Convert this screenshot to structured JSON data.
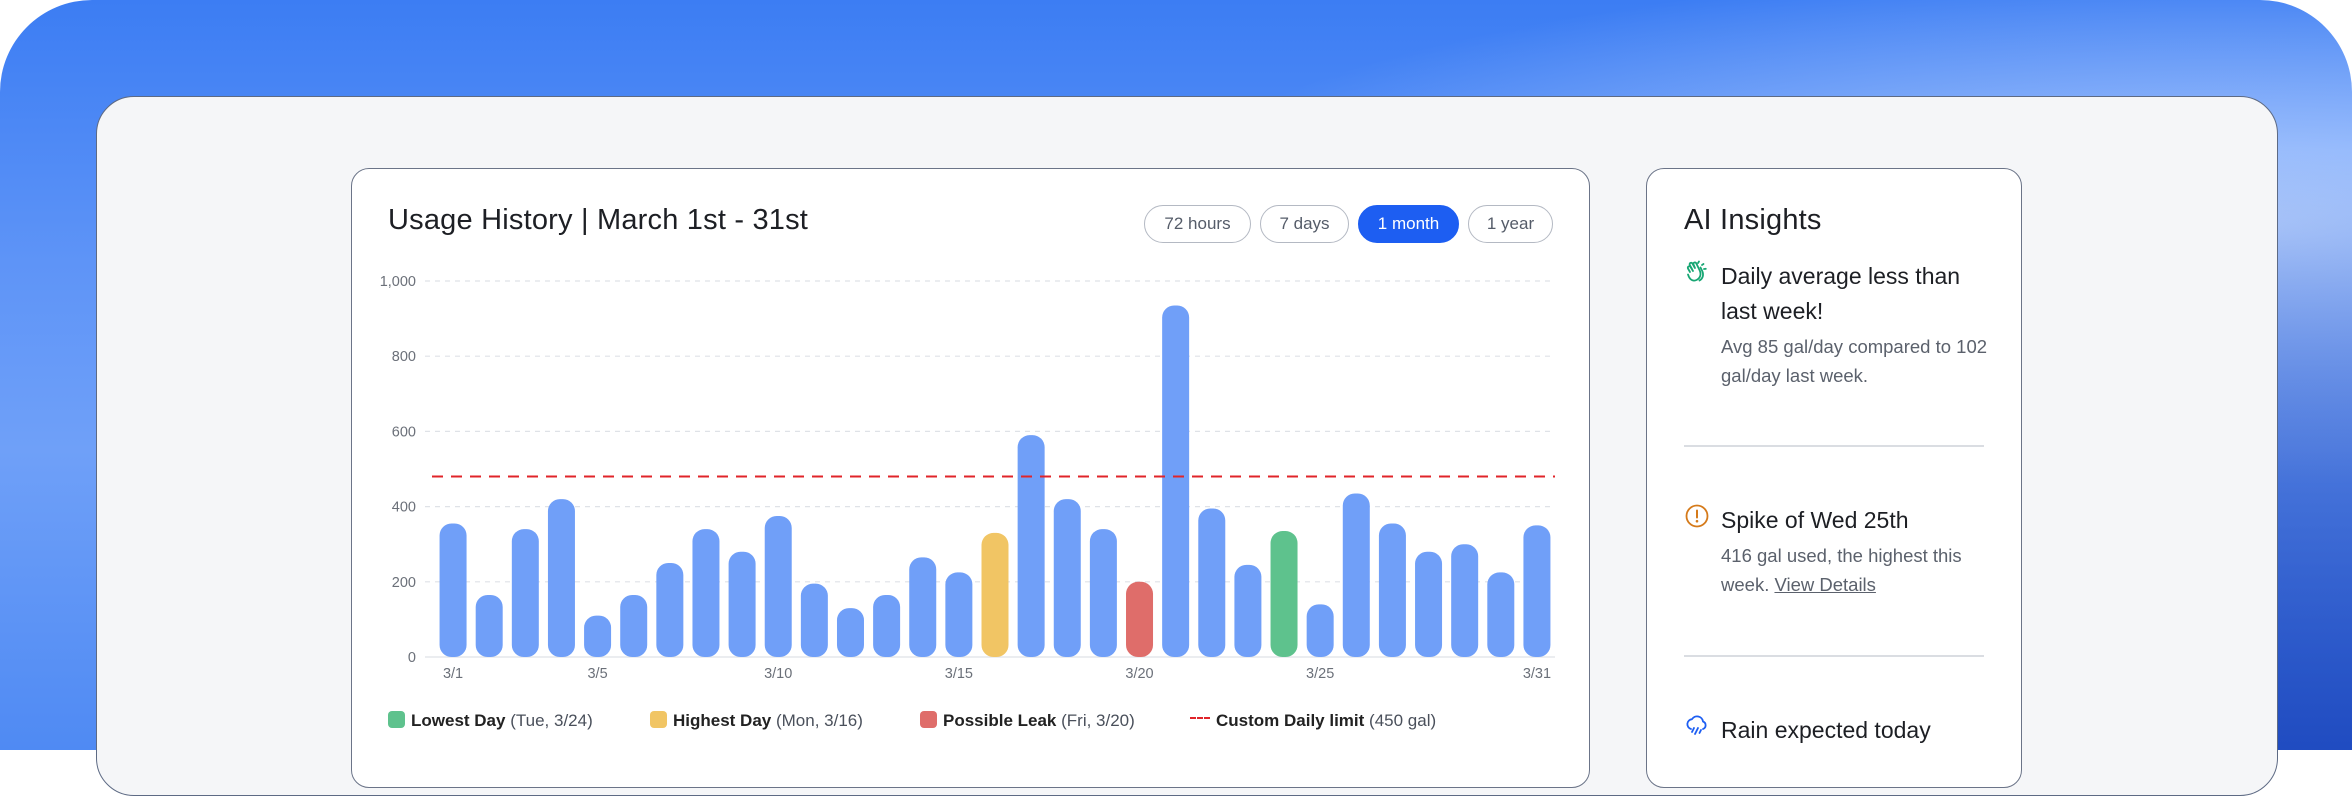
{
  "usage": {
    "title": "Usage History | March 1st - 31st",
    "ranges": [
      "72 hours",
      "7 days",
      "1 month",
      "1 year"
    ],
    "active_range": "1 month"
  },
  "colors": {
    "accent": "#1d5ef2",
    "bar": "#709ff8",
    "lowest": "#5ec28d",
    "highest": "#f1c564",
    "leak": "#df6d6a",
    "limit_line": "#e0242a"
  },
  "chart_data": {
    "type": "bar",
    "categories": [
      "3/1",
      "3/2",
      "3/3",
      "3/4",
      "3/5",
      "3/6",
      "3/7",
      "3/8",
      "3/9",
      "3/10",
      "3/11",
      "3/12",
      "3/13",
      "3/14",
      "3/15",
      "3/16",
      "3/17",
      "3/18",
      "3/19",
      "3/20",
      "3/21",
      "3/22",
      "3/23",
      "3/24",
      "3/25",
      "3/26",
      "3/27",
      "3/28",
      "3/29",
      "3/30",
      "3/31"
    ],
    "values": [
      355,
      165,
      340,
      420,
      110,
      165,
      250,
      340,
      280,
      375,
      195,
      130,
      165,
      265,
      225,
      330,
      590,
      420,
      340,
      200,
      935,
      395,
      245,
      335,
      140,
      435,
      355,
      280,
      300,
      225,
      350
    ],
    "highlight": {
      "3/16": "highest",
      "3/20": "leak",
      "3/24": "lowest"
    },
    "x_tick_labels": [
      "3/1",
      "3/5",
      "3/10",
      "3/15",
      "3/20",
      "3/25",
      "3/31"
    ],
    "y_ticks": [
      "0",
      "200",
      "400",
      "600",
      "800",
      "1,000"
    ],
    "ylim": [
      0,
      1000
    ],
    "limit_value": 480,
    "grid": true,
    "legend": [
      {
        "key": "lowest",
        "label": "Lowest Day",
        "detail": "(Tue, 3/24)"
      },
      {
        "key": "highest",
        "label": "Highest Day",
        "detail": "(Mon, 3/16)"
      },
      {
        "key": "leak",
        "label": "Possible Leak",
        "detail": "(Fri, 3/20)"
      },
      {
        "key": "limit",
        "label": "Custom Daily limit",
        "detail": "(450 gal)"
      }
    ],
    "legend_position": "bottom"
  },
  "insights": {
    "title": "AI Insights",
    "items": [
      {
        "icon": "clapping-hands-icon",
        "heading": "Daily average less than last week!",
        "body": "Avg 85 gal/day compared to 102 gal/day last week.",
        "link": ""
      },
      {
        "icon": "alert-circle-icon",
        "heading": "Spike of Wed 25th",
        "body": "416 gal used, the highest this week.",
        "link": "View Details"
      },
      {
        "icon": "cloud-rain-icon",
        "heading": "Rain expected today",
        "body": "",
        "link": ""
      }
    ]
  }
}
